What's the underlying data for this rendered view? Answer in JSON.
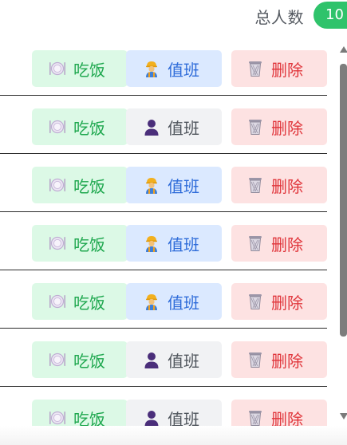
{
  "header": {
    "total_label": "总人数",
    "total_count": "10"
  },
  "colors": {
    "badge": "#2fc36b",
    "eat_bg": "#dcf9e6",
    "eat_text": "#1fa84f",
    "duty_on_bg": "#dbe9ff",
    "duty_on_text": "#2d6bd9",
    "duty_off_bg": "#f1f2f4",
    "duty_off_text": "#4f555c",
    "delete_bg": "#fde2e2",
    "delete_text": "#e0353b"
  },
  "rows": [
    {
      "eat_label": "吃饭",
      "eat_icon": "plate-icon",
      "duty_label": "值班",
      "duty_icon": "worker-icon",
      "duty_state": "on",
      "delete_label": "删除",
      "delete_icon": "trash-icon"
    },
    {
      "eat_label": "吃饭",
      "eat_icon": "plate-icon",
      "duty_label": "值班",
      "duty_icon": "person-silhouette-icon",
      "duty_state": "off",
      "delete_label": "删除",
      "delete_icon": "trash-icon"
    },
    {
      "eat_label": "吃饭",
      "eat_icon": "plate-icon",
      "duty_label": "值班",
      "duty_icon": "worker-icon",
      "duty_state": "on",
      "delete_label": "删除",
      "delete_icon": "trash-icon"
    },
    {
      "eat_label": "吃饭",
      "eat_icon": "plate-icon",
      "duty_label": "值班",
      "duty_icon": "worker-icon",
      "duty_state": "on",
      "delete_label": "删除",
      "delete_icon": "trash-icon"
    },
    {
      "eat_label": "吃饭",
      "eat_icon": "plate-icon",
      "duty_label": "值班",
      "duty_icon": "worker-icon",
      "duty_state": "on",
      "delete_label": "删除",
      "delete_icon": "trash-icon"
    },
    {
      "eat_label": "吃饭",
      "eat_icon": "plate-icon",
      "duty_label": "值班",
      "duty_icon": "person-silhouette-icon",
      "duty_state": "off",
      "delete_label": "删除",
      "delete_icon": "trash-icon"
    },
    {
      "eat_label": "吃饭",
      "eat_icon": "plate-icon",
      "duty_label": "值班",
      "duty_icon": "person-silhouette-icon",
      "duty_state": "off",
      "delete_label": "删除",
      "delete_icon": "trash-icon"
    }
  ]
}
